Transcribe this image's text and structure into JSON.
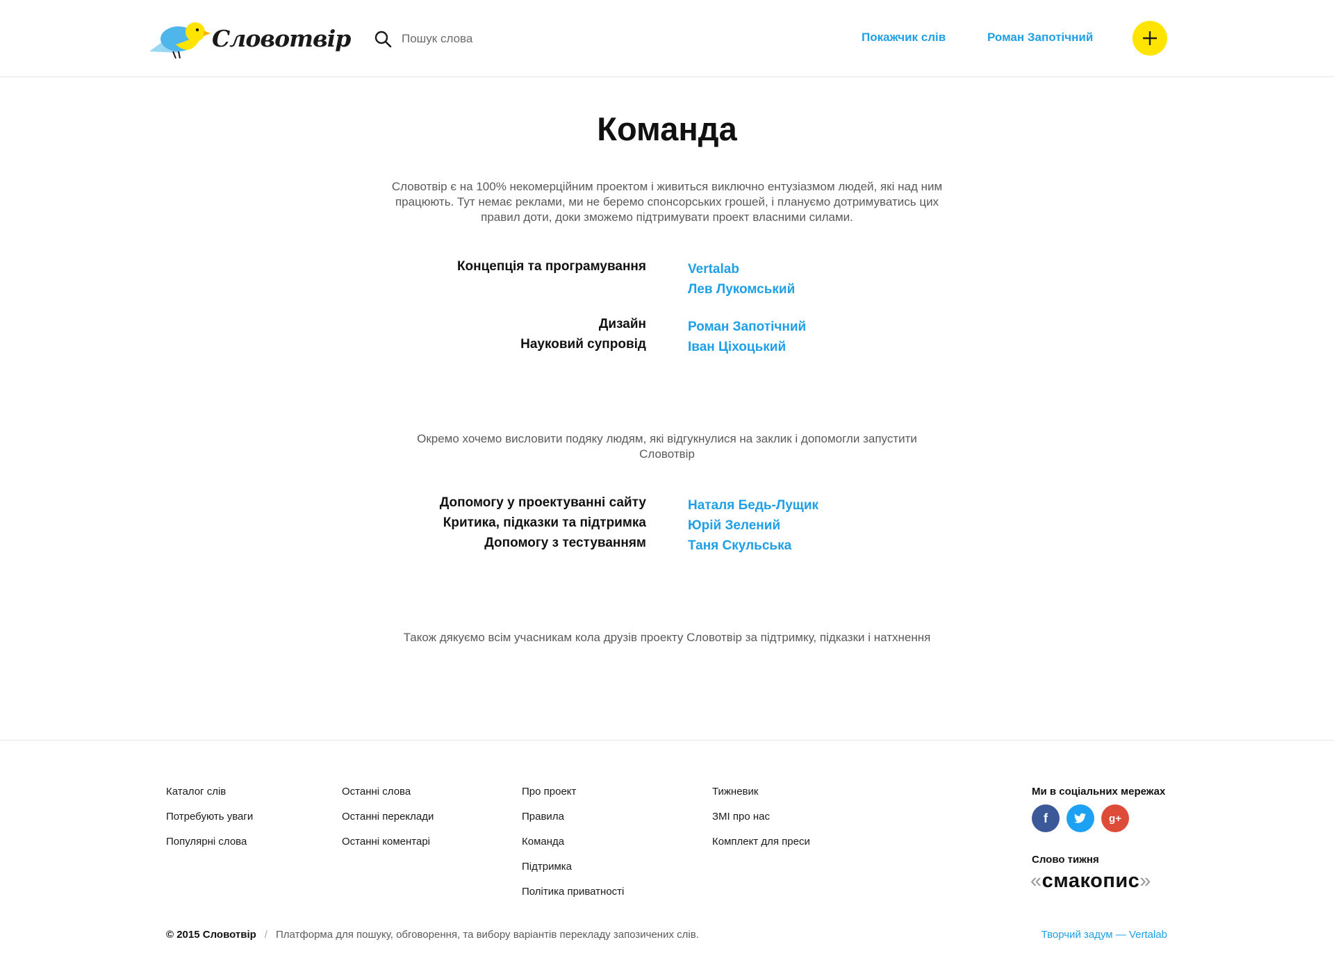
{
  "header": {
    "logo_text": "Словотвір",
    "search_placeholder": "Пошук слова",
    "nav_index": "Покажчик слів",
    "nav_user": "Роман Запотічний",
    "add_button_icon": "plus-icon",
    "accent_color": "#ffe400",
    "link_color": "#1fa0e6"
  },
  "main": {
    "title": "Команда",
    "intro": "Словотвір є на 100% некомерційним проектом і живиться виключно ентузіазмом людей, які над ним працюють. Тут немає реклами, ми не беремо спонсорських грошей, і плануємо дотримуватись цих правил доти, доки зможемо підтримувати проект власними силами.",
    "team": [
      {
        "role": "Концепція та програмування",
        "names": [
          "Vertalab",
          "Лев Лукомський"
        ]
      },
      {
        "role": "Дизайн",
        "names": [
          "Роман Запотічний"
        ]
      },
      {
        "role": "Науковий супровід",
        "names": [
          "Іван Ціхоцький"
        ]
      }
    ],
    "thanks_intro": "Окремо хочемо висловити подяку людям, які відгукнулися на заклик і допомогли запустити Словотвір",
    "helpers": [
      {
        "role": "Допомогу у проектуванні сайту",
        "names": [
          "Наталя Бедь-Лущик"
        ]
      },
      {
        "role": "Критика, підказки та підтримка",
        "names": [
          "Юрій Зелений"
        ]
      },
      {
        "role": "Допомогу з тестуванням",
        "names": [
          "Таня Скульська"
        ]
      }
    ],
    "thanks_outro": "Також дякуємо всім учасникам кола друзів проекту Словотвір за підтримку, підказки і натхнення"
  },
  "footer": {
    "col1": [
      "Каталог слів",
      "Потребують уваги",
      "Популярні слова"
    ],
    "col2": [
      "Останні слова",
      "Останні переклади",
      "Останні коментарі"
    ],
    "col3": [
      "Про проект",
      "Правила",
      "Команда",
      "Підтримка",
      "Політика приватності"
    ],
    "col4": [
      "Тижневик",
      "ЗМІ про нас",
      "Комплект для преси"
    ],
    "social_title": "Ми в соціальних мережах",
    "social": [
      "facebook-icon",
      "twitter-icon",
      "google-plus-icon"
    ],
    "word_of_week_label": "Слово тижня",
    "word_of_week": "смакопис",
    "copyright_brand": "© 2015 Словотвір",
    "tagline": "Платформа для пошуку, обговорення, та вибору варіантів перекладу запозичених слів.",
    "credit": "Творчий задум — Vertalab"
  }
}
